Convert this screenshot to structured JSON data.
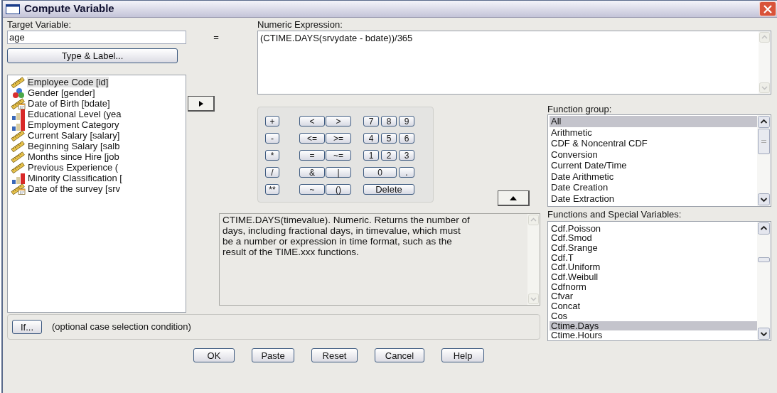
{
  "window": {
    "title": "Compute Variable"
  },
  "target_variable": {
    "label": "Target Variable:",
    "value": "age"
  },
  "equals": "=",
  "type_label_button": "Type & Label...",
  "variables": [
    {
      "name": "Employee Code [id]",
      "kind": "scale",
      "selected": true
    },
    {
      "name": "Gender [gender]",
      "kind": "nominal",
      "selected": false
    },
    {
      "name": "Date of Birth [bdate]",
      "kind": "date",
      "selected": false
    },
    {
      "name": "Educational Level (yea",
      "kind": "ordinal",
      "selected": false
    },
    {
      "name": "Employment Category",
      "kind": "ordinal",
      "selected": false
    },
    {
      "name": "Current Salary [salary]",
      "kind": "scale",
      "selected": false
    },
    {
      "name": "Beginning Salary [salb",
      "kind": "scale",
      "selected": false
    },
    {
      "name": "Months since Hire [job",
      "kind": "scale",
      "selected": false
    },
    {
      "name": "Previous Experience (",
      "kind": "scale",
      "selected": false
    },
    {
      "name": "Minority Classification [",
      "kind": "ordinal",
      "selected": false
    },
    {
      "name": "Date of the survey [srv",
      "kind": "date",
      "selected": false
    }
  ],
  "numeric_expression": {
    "label": "Numeric Expression:",
    "value": "(CTIME.DAYS(srvydate - bdate))/365"
  },
  "keypad": {
    "operators": [
      "+",
      "-",
      "*",
      "/",
      "**"
    ],
    "relations": [
      [
        "<",
        ">"
      ],
      [
        "<=",
        ">="
      ],
      [
        "=",
        "~="
      ],
      [
        "&",
        "|"
      ],
      [
        "~",
        "()"
      ]
    ],
    "digits": [
      [
        "7",
        "8",
        "9"
      ],
      [
        "4",
        "5",
        "6"
      ],
      [
        "1",
        "2",
        "3"
      ],
      [
        "0",
        "."
      ],
      [
        "Delete"
      ]
    ]
  },
  "description": "CTIME.DAYS(timevalue). Numeric. Returns the number of days, including fractional days, in timevalue, which must be a number or expression in time format, such as the result of the TIME.xxx functions.",
  "function_group": {
    "label": "Function group:",
    "items": [
      {
        "label": "All",
        "selected": true
      },
      {
        "label": "Arithmetic",
        "selected": false
      },
      {
        "label": "CDF & Noncentral CDF",
        "selected": false
      },
      {
        "label": "Conversion",
        "selected": false
      },
      {
        "label": "Current Date/Time",
        "selected": false
      },
      {
        "label": "Date Arithmetic",
        "selected": false
      },
      {
        "label": "Date Creation",
        "selected": false
      },
      {
        "label": "Date Extraction",
        "selected": false
      }
    ]
  },
  "functions": {
    "label": "Functions and Special Variables:",
    "items": [
      {
        "label": "Cdf.Poisson",
        "selected": false
      },
      {
        "label": "Cdf.Smod",
        "selected": false
      },
      {
        "label": "Cdf.Srange",
        "selected": false
      },
      {
        "label": "Cdf.T",
        "selected": false
      },
      {
        "label": "Cdf.Uniform",
        "selected": false
      },
      {
        "label": "Cdf.Weibull",
        "selected": false
      },
      {
        "label": "Cdfnorm",
        "selected": false
      },
      {
        "label": "Cfvar",
        "selected": false
      },
      {
        "label": "Concat",
        "selected": false
      },
      {
        "label": "Cos",
        "selected": false
      },
      {
        "label": "Ctime.Days",
        "selected": true
      },
      {
        "label": "Ctime.Hours",
        "selected": false
      }
    ]
  },
  "if_button": "If...",
  "if_condition": "(optional case selection condition)",
  "buttons": [
    "OK",
    "Paste",
    "Reset",
    "Cancel",
    "Help"
  ]
}
